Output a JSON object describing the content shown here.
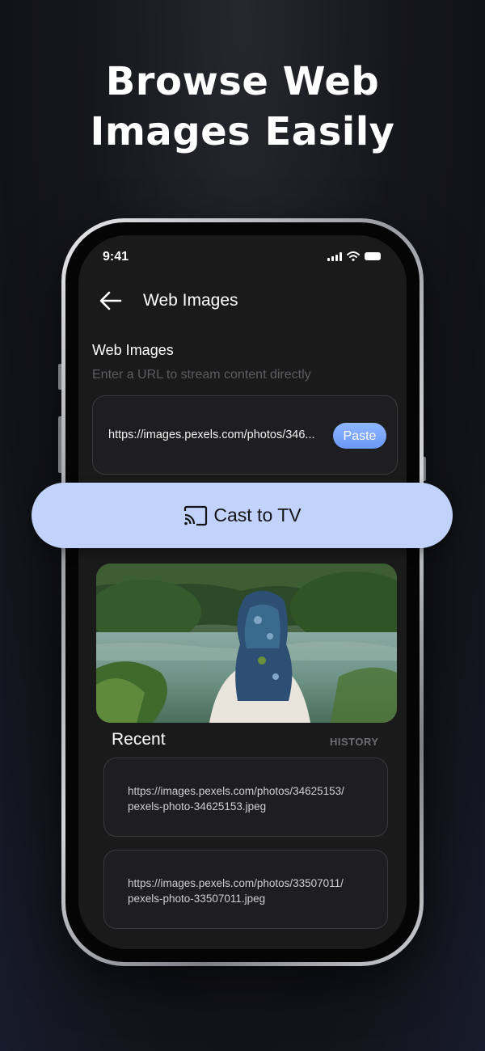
{
  "headline": {
    "line1": "Browse Web",
    "line2": "Images Easily"
  },
  "status_bar": {
    "time": "9:41",
    "icons": [
      "cellular-signal-icon",
      "wifi-icon",
      "battery-icon"
    ]
  },
  "nav": {
    "back_icon": "arrow-left-icon",
    "title": "Web Images"
  },
  "url_section": {
    "title": "Web Images",
    "subtitle": "Enter a URL to stream content directly",
    "url_value": "https://images.pexels.com/photos/346...",
    "paste_label": "Paste"
  },
  "cast": {
    "icon": "cast-icon",
    "label": "Cast to TV"
  },
  "preview": {
    "image": "woman-in-headscarf-by-lake-photo"
  },
  "recent": {
    "title": "Recent",
    "history_label": "HISTORY",
    "items": [
      {
        "line1": "https://images.pexels.com/photos/34625153/",
        "line2": "pexels-photo-34625153.jpeg"
      },
      {
        "line1": "https://images.pexels.com/photos/33507011/",
        "line2": "pexels-photo-33507011.jpeg"
      }
    ]
  },
  "colors": {
    "accent": "#6a97f3",
    "cast_bar": "#c2d3fb",
    "screen_bg": "#1b1a1b"
  }
}
